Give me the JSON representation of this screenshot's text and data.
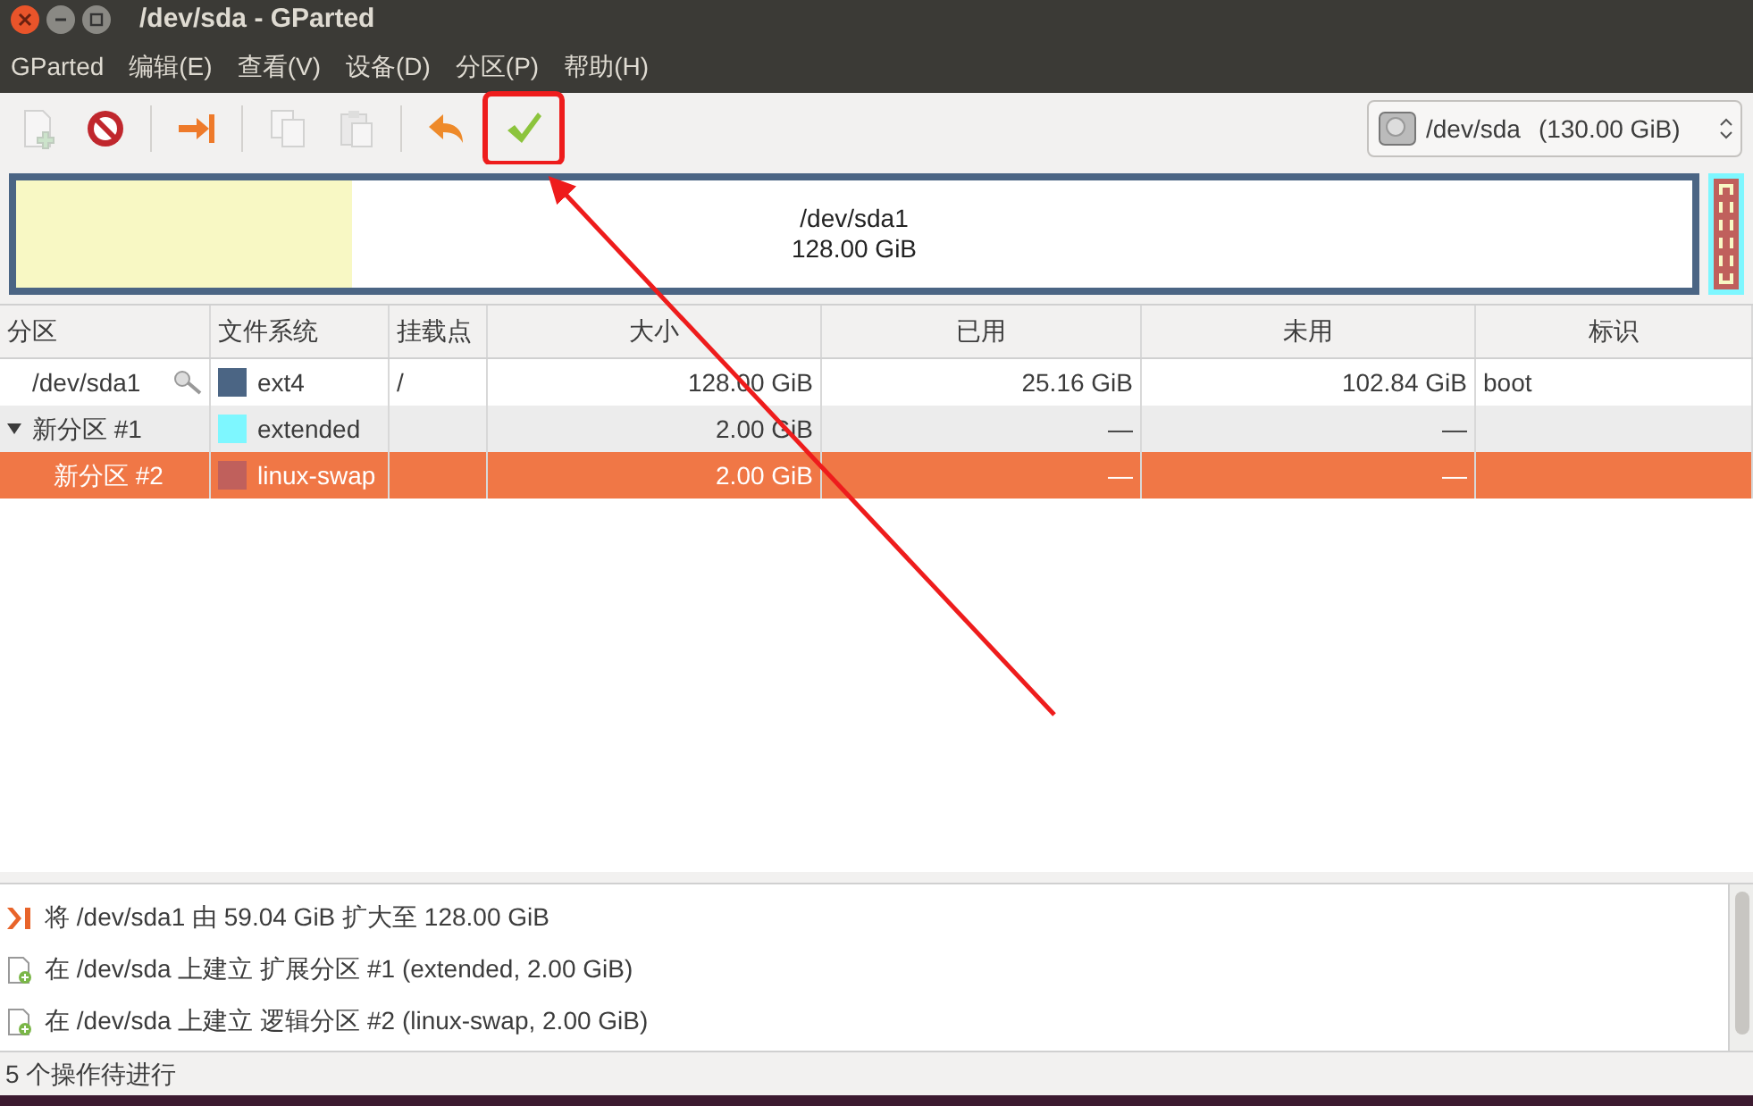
{
  "window": {
    "title": "/dev/sda - GParted"
  },
  "menu": [
    "GParted",
    "编辑(E)",
    "查看(V)",
    "设备(D)",
    "分区(P)",
    "帮助(H)"
  ],
  "toolbar": [
    {
      "kind": "new",
      "disabled": true,
      "highlighted": false
    },
    {
      "kind": "delete",
      "disabled": false,
      "highlighted": false
    },
    {
      "kind": "separator"
    },
    {
      "kind": "resize",
      "disabled": false,
      "highlighted": false
    },
    {
      "kind": "separator"
    },
    {
      "kind": "copy",
      "disabled": true,
      "highlighted": false
    },
    {
      "kind": "paste",
      "disabled": true,
      "highlighted": false
    },
    {
      "kind": "separator"
    },
    {
      "kind": "undo",
      "disabled": false,
      "highlighted": false
    },
    {
      "kind": "apply",
      "disabled": false,
      "highlighted": true
    }
  ],
  "device": {
    "name": "/dev/sda",
    "size": "(130.00 GiB)"
  },
  "disk_map": {
    "name": "/dev/sda1",
    "size": "128.00 GiB",
    "level": 0.2
  },
  "table": {
    "columns": [
      "分区",
      "文件系统",
      "挂载点",
      "大小",
      "已用",
      "未用",
      "标识"
    ],
    "rows": [
      {
        "partition": "/dev/sda1",
        "mounted": true,
        "color": "#4b6584",
        "filesystem": "ext4",
        "mount_point": "/",
        "size": "128.00 GiB",
        "used": "25.16 GiB",
        "unused": "102.84 GiB",
        "flags": "boot",
        "selected": false
      },
      {
        "partition": "新分区 #1",
        "expanded": true,
        "color": "#7ef7ff",
        "filesystem": "extended",
        "size": "2.00 GiB",
        "used": "—",
        "unused": "—",
        "selected": false,
        "children": [
          {
            "partition": "新分区 #2",
            "mounted": false,
            "color": "#c0605c",
            "filesystem": "linux-swap",
            "size": "2.00 GiB",
            "used": "—",
            "unused": "—",
            "selected": true
          }
        ]
      }
    ]
  },
  "operations": [
    {
      "kind": "resize",
      "text": "将 /dev/sda1 由 59.04 GiB 扩大至 128.00 GiB"
    },
    {
      "kind": "create",
      "text": "在 /dev/sda 上建立 扩展分区 #1 (extended, 2.00 GiB)"
    },
    {
      "kind": "create",
      "text": "在 /dev/sda 上建立 逻辑分区 #2 (linux-swap, 2.00 GiB)"
    }
  ],
  "status_bar": "5 个操作待进行"
}
